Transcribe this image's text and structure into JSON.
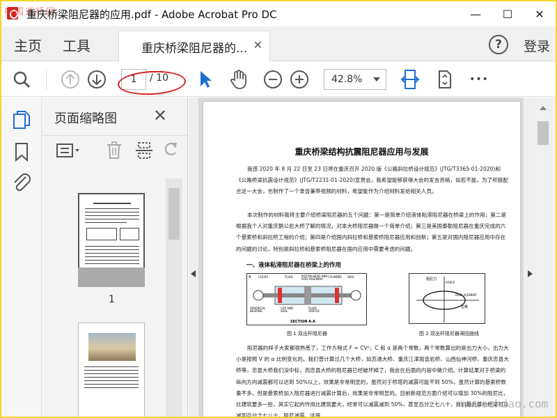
{
  "window": {
    "title": "重庆桥梁阻尼器的应用.pdf - Adobe Acrobat Pro DC",
    "watermark_top": "中国道桥网",
    "watermark_bottom": "www.chdao.com",
    "controls": {
      "minimize": "—",
      "maximize": "☐",
      "close": "✕"
    }
  },
  "tabs": {
    "home": "主页",
    "tools": "工具",
    "document": "重庆桥梁阻尼器的...",
    "document_close": "✕",
    "help": "?",
    "login": "登录"
  },
  "toolbar": {
    "current_page": "1",
    "total_pages": "/ 10",
    "zoom": "42.8%",
    "more": "•••"
  },
  "thumbnails": {
    "title": "页面缩略图",
    "close": "✕",
    "page_label": "1"
  },
  "doc": {
    "title": "重庆桥梁结构抗震阻尼器应用与发展",
    "para1": "我感 2020 年 8 月 22 日至 23 日将在重庆召开 2020 版《公路斜拉桥设计规范》(JTG/T3365-01-2020)和《公路桥梁抗震设计规范》(JTG/T2231-01-2020)宣贯会，我希望能够获得大会的发言资格，如若不能，为了积极配合这一大会，也制作了一个录音兼带视频的材料，希望能作为介绍材料发给相关人员。",
    "para2": "本次制作的材料我将主要介绍桥梁阻尼器的五个问题：第一是简单介绍液体粘滞阻尼器在桥梁上的作用；第二是根据我个人对重庆鹅公岩大桥了解的情况，对本大桥阻尼器做一个简单介绍；第三是美国泰勒阻尼器在重庆完成的六个悬索桥和斜拉桥工程的介绍；第四是介绍国内斜拉桥和悬索桥阻尼器应用和创新；第五是对国内阻尼器应用中存在的问题的讨论，特别是斜拉桥和悬索桥阻尼器在国内应用中需要考虑的问题。",
    "section1": "一、液体粘滞阻尼器在桥梁上的作用",
    "fig1_caption": "图 1 双出杆阻尼器",
    "fig2_caption": "图 2 双出杆阻尼器滞回曲线",
    "fig1_labels": {
      "section": "SECTION A-A",
      "clevis": "CLEVIS",
      "fluid": "FLUID",
      "piston": "PISTON HEAD AND ROD ASSEMBLY",
      "cylinder": "CYLINDER",
      "seal": "SEAL",
      "bearing": "SPHERICAL BEARING",
      "cap": "CAP AND SEAL",
      "orifice": "FLUID ORIFICE",
      "a": "A"
    },
    "fig2_labels": {
      "force_cn": "阻尼力",
      "force": "FORCE",
      "disp": "DISPLACEMENT",
      "disp_cn": "位移"
    },
    "para3": "阻尼器的样子大家都很熟悉了，工作方程式 F = CVᵅ，C 和 α 是两个常数，两个常数算出的是出力大小，出力大小是按照 V 的 α 比例变化的。我们曾计算过几个大桥，如苏通大桥、重庆江津观音岩桥、山西仙神河桥、重庆忠县大桥等，忠县大桥我们没中标，而忠县大桥的阻尼器已经破坏掉了，我会在后面的内容中做介绍。计算结果对于桥梁的纵向方向减震都可以达到 50%以上，效果是非常明显的，虽然对于桥塔的减震可能不到 50%，虽然计算的悬索桥数量不多，但是悬索桥加入阻尼器进行减震计算后，效果是非常明显的。目前新规范方面介绍可以增加 30%的阻尼比，比建筑要多一些，其实它起的作用比建筑要大，经常可以减震减到 50%，甚至百分之七八十，我们最近算的桥梁可以减到百分之七八十，阻尼减震、这是"
  }
}
